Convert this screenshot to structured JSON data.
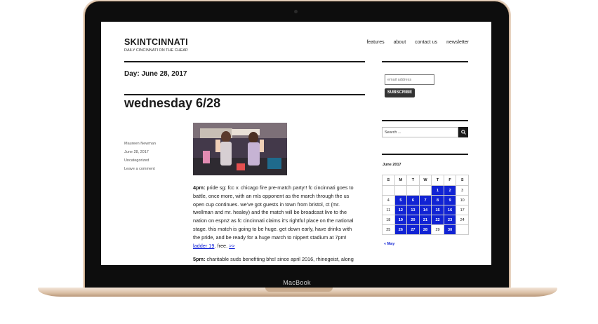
{
  "device": {
    "brand": "MacBook"
  },
  "site": {
    "title": "SKINTCINNATI",
    "tagline": "DAILY CINCINNATI ON THE CHEAP."
  },
  "nav": [
    "features",
    "about",
    "contact us",
    "newsletter"
  ],
  "archive_title": "Day: June 28, 2017",
  "post": {
    "title": "wednesday 6/28",
    "meta": {
      "author": "Maureen Newman",
      "date": "June 28, 2017",
      "category": "Uncategorized",
      "comments": "Leave a comment"
    },
    "image_alt": "gif",
    "p1": {
      "time": "4pm:",
      "text": " pride sg: fcc v. chicago fire pre-match party!! fc cincinnati goes to battle, once more, with an mls opponent as the march through the us open cup continues. we've got guests in town from bristol, ct (mr. twellman and mr. healey) and the match will be broadcast live to the nation on espn2 as fc cincinnati claims it's rightful place on the national stage. this match is going to be huge. get down early, have drinks with the pride, and be ready for a huge march to nippert stadium at 7pm! ",
      "link": "ladder 19",
      "after": ". free. ",
      "more": ">>"
    },
    "p2": {
      "time": "5pm:",
      "text": " charitable suds benefiting bhs! since april 2016, rhinegeist, along"
    }
  },
  "sidebar": {
    "email_placeholder": "email address",
    "subscribe_label": "SUBSCRIBE",
    "search_placeholder": "Search ...",
    "calendar": {
      "caption": "June 2017",
      "weekdays": [
        "S",
        "M",
        "T",
        "W",
        "T",
        "F",
        "S"
      ],
      "rows": [
        [
          {
            "d": ""
          },
          {
            "d": ""
          },
          {
            "d": ""
          },
          {
            "d": ""
          },
          {
            "d": "1",
            "link": true
          },
          {
            "d": "2",
            "link": true
          },
          {
            "d": "3"
          }
        ],
        [
          {
            "d": "4"
          },
          {
            "d": "5",
            "link": true
          },
          {
            "d": "6",
            "link": true
          },
          {
            "d": "7",
            "link": true
          },
          {
            "d": "8",
            "link": true
          },
          {
            "d": "9",
            "link": true
          },
          {
            "d": "10"
          }
        ],
        [
          {
            "d": "11"
          },
          {
            "d": "12",
            "link": true
          },
          {
            "d": "13",
            "link": true
          },
          {
            "d": "14",
            "link": true
          },
          {
            "d": "15",
            "link": true
          },
          {
            "d": "16",
            "link": true
          },
          {
            "d": "17"
          }
        ],
        [
          {
            "d": "18"
          },
          {
            "d": "19",
            "link": true
          },
          {
            "d": "20",
            "link": true
          },
          {
            "d": "21",
            "link": true
          },
          {
            "d": "22",
            "link": true
          },
          {
            "d": "23",
            "link": true
          },
          {
            "d": "24"
          }
        ],
        [
          {
            "d": "25"
          },
          {
            "d": "26",
            "link": true
          },
          {
            "d": "27",
            "link": true
          },
          {
            "d": "28",
            "link": true
          },
          {
            "d": "29"
          },
          {
            "d": "30",
            "link": true
          },
          {
            "d": ""
          }
        ]
      ],
      "prev": "« May"
    }
  },
  "colors": {
    "calendar_link": "#1123d4",
    "text": "#1a1a1a",
    "post_link": "#0a1bd6"
  }
}
